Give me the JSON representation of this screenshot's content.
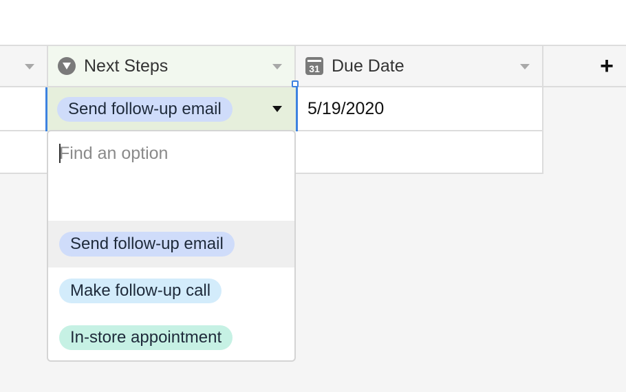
{
  "grid": {
    "columns": [
      {
        "name": "Next Steps",
        "icon": "single-select-icon"
      },
      {
        "name": "Due Date",
        "icon": "calendar-icon",
        "icon_text": "31"
      }
    ],
    "add_column_label": "+",
    "row1": {
      "next_steps": "Send follow-up email",
      "due_date": "5/19/2020"
    }
  },
  "dropdown": {
    "search_placeholder": "Find an option",
    "search_value": "",
    "options": [
      {
        "label": "Send follow-up email",
        "color": "#cfdcfa",
        "highlighted": true
      },
      {
        "label": "Make follow-up call",
        "color": "#d3ecfb",
        "highlighted": false
      },
      {
        "label": "In-store appointment",
        "color": "#c6f1e4",
        "highlighted": false
      }
    ]
  },
  "colors": {
    "accent": "#3d82e0",
    "selected_cell": "#e6efdc",
    "header_selected": "#f2f8ef"
  }
}
